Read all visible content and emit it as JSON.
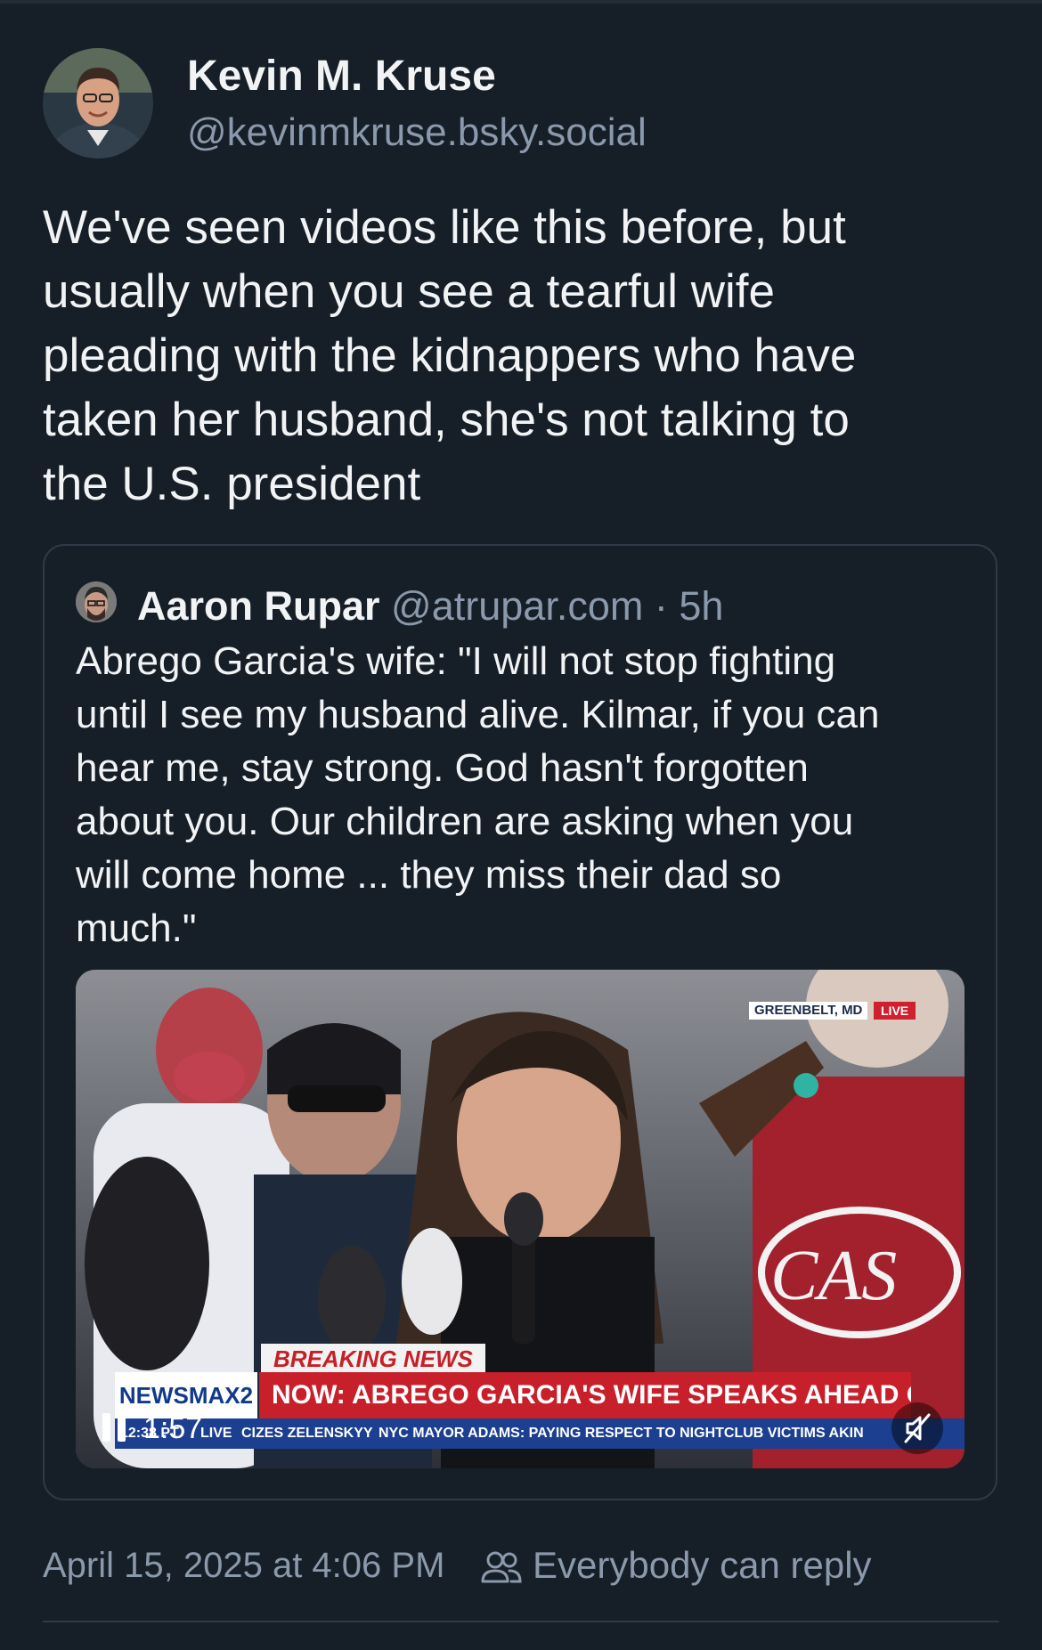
{
  "author": {
    "name": "Kevin M. Kruse",
    "handle": "@kevinmkruse.bsky.social",
    "avatar_icon": "user-photo-avatar"
  },
  "post": {
    "text": "We've seen videos like this before, but\nusually when you see a tearful wife\npleading with the kidnappers who have\ntaken her husband, she's not talking to\nthe U.S. president"
  },
  "quote": {
    "name": "Aaron Rupar",
    "handle": "@atrupar.com",
    "time": "· 5h",
    "avatar_icon": "user-photo-avatar",
    "text": "Abrego Garcia's wife: \"I will not stop fighting\nuntil I see my husband alive. Kilmar, if you can\nhear me, stay strong. God hasn't forgotten\nabout you. Our children are asking when you\nwill come home ... they miss their dad so\nmuch.\"",
    "video": {
      "duration": "1:57",
      "play_state_icon": "pause-icon",
      "sound_icon": "muted-speaker-icon",
      "overlay": {
        "location": "GREENBELT, MD",
        "live": "LIVE",
        "breaking": "BREAKING NEWS",
        "network": "NEWSMAX2",
        "headline": "NOW: ABREGO GARCIA'S WIFE SPEAKS AHEAD OF HEARING",
        "ticker_left": "CIZES ZELENSKYY",
        "ticker_right": "NYC MAYOR ADAMS: PAYING RESPECT TO NIGHTCLUB VICTIMS AKIN",
        "clock": "12:38 PT",
        "clock_live": "LIVE"
      }
    }
  },
  "footer": {
    "date": "April 15, 2025 at 4:06 PM",
    "reply_setting": "Everybody can reply",
    "reply_icon": "people-icon"
  },
  "colors": {
    "background": "#161e27",
    "text_primary": "#f1f3f5",
    "text_secondary": "#8a99ab",
    "border": "#2e3a47",
    "news_red": "#c8202b",
    "news_blue": "#1d3f8f"
  }
}
